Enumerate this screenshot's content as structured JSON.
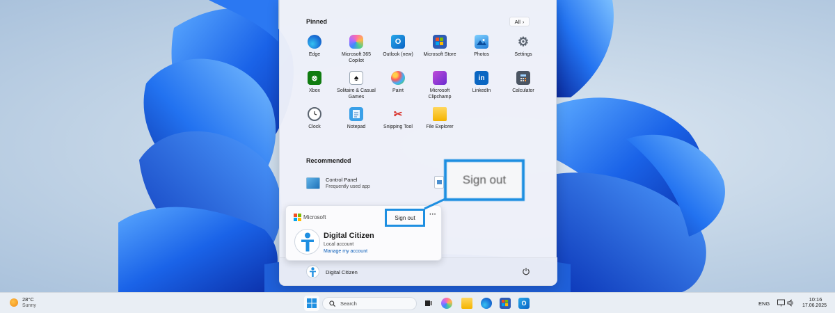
{
  "start_menu": {
    "pinned_title": "Pinned",
    "all_button_label": "All",
    "pinned_apps": [
      {
        "label": "Edge",
        "icon": "edge-icon"
      },
      {
        "label": "Microsoft 365 Copilot",
        "icon": "microsoft-365-copilot-icon"
      },
      {
        "label": "Outlook (new)",
        "icon": "outlook-icon"
      },
      {
        "label": "Microsoft Store",
        "icon": "microsoft-store-icon"
      },
      {
        "label": "Photos",
        "icon": "photos-icon"
      },
      {
        "label": "Settings",
        "icon": "settings-gear-icon"
      },
      {
        "label": "Xbox",
        "icon": "xbox-icon"
      },
      {
        "label": "Solitaire & Casual Games",
        "icon": "solitaire-icon"
      },
      {
        "label": "Paint",
        "icon": "paint-palette-icon"
      },
      {
        "label": "Microsoft Clipchamp",
        "icon": "clipchamp-icon"
      },
      {
        "label": "LinkedIn",
        "icon": "linkedin-icon"
      },
      {
        "label": "Calculator",
        "icon": "calculator-icon"
      },
      {
        "label": "Clock",
        "icon": "clock-icon"
      },
      {
        "label": "Notepad",
        "icon": "notepad-icon"
      },
      {
        "label": "Snipping Tool",
        "icon": "snipping-tool-icon"
      },
      {
        "label": "File Explorer",
        "icon": "file-explorer-folder-icon"
      }
    ],
    "recommended_title": "Recommended",
    "recommended": [
      {
        "name": "Control Panel",
        "subtitle": "Frequently used app"
      }
    ],
    "footer_username": "Digital Citizen"
  },
  "account_card": {
    "brand": "Microsoft",
    "sign_out_label": "Sign out",
    "more_label": "···",
    "name": "Digital Citizen",
    "account_type": "Local account",
    "manage_link": "Manage my account"
  },
  "callout": {
    "label": "Sign out",
    "color": "#1e8fe1"
  },
  "taskbar": {
    "weather_temp": "28°C",
    "weather_condition": "Sunny",
    "search_placeholder": "Search",
    "language": "ENG",
    "time": "10:16",
    "date": "17.06.2025",
    "pinned_icons": [
      "task-view-icon",
      "copilot-icon",
      "file-explorer-icon",
      "edge-icon",
      "microsoft-store-icon",
      "outlook-icon"
    ]
  },
  "colors": {
    "accent": "#1e8fe1",
    "wallpaper_blue": "#1560e0"
  }
}
